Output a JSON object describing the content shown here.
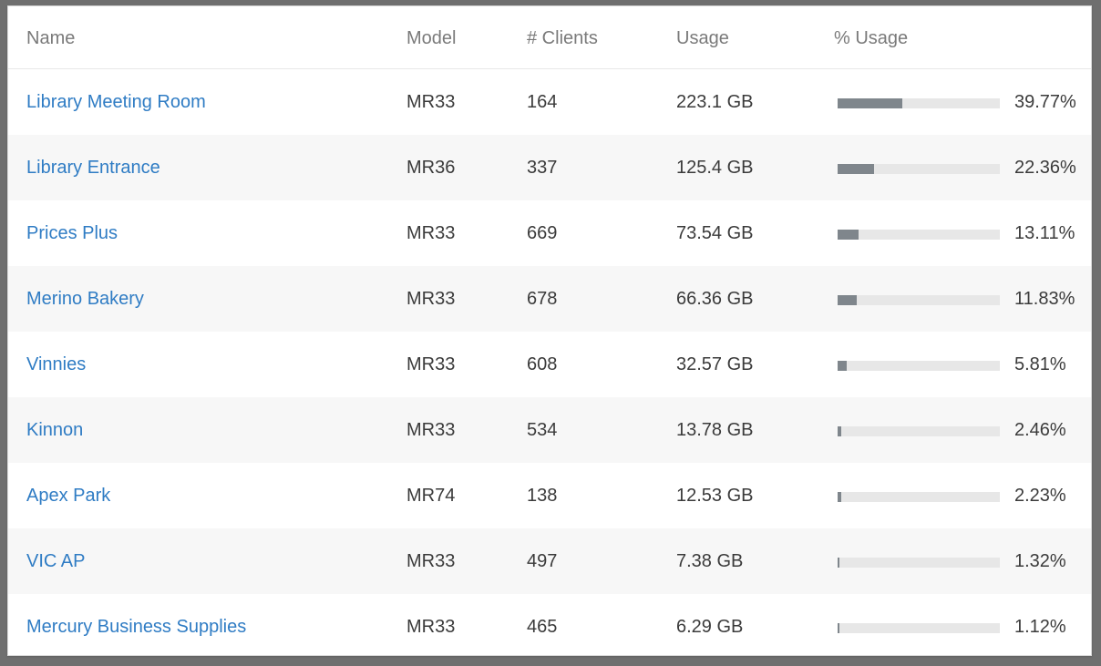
{
  "table": {
    "headers": {
      "name": "Name",
      "model": "Model",
      "clients": "# Clients",
      "usage": "Usage",
      "pct_usage": "% Usage"
    },
    "rows": [
      {
        "name": "Library Meeting Room",
        "model": "MR33",
        "clients": "164",
        "usage": "223.1 GB",
        "pct_label": "39.77%",
        "pct_value": 39.77
      },
      {
        "name": "Library Entrance",
        "model": "MR36",
        "clients": "337",
        "usage": "125.4 GB",
        "pct_label": "22.36%",
        "pct_value": 22.36
      },
      {
        "name": "Prices Plus",
        "model": "MR33",
        "clients": "669",
        "usage": "73.54 GB",
        "pct_label": "13.11%",
        "pct_value": 13.11
      },
      {
        "name": "Merino Bakery",
        "model": "MR33",
        "clients": "678",
        "usage": "66.36 GB",
        "pct_label": "11.83%",
        "pct_value": 11.83
      },
      {
        "name": "Vinnies",
        "model": "MR33",
        "clients": "608",
        "usage": "32.57 GB",
        "pct_label": "5.81%",
        "pct_value": 5.81
      },
      {
        "name": "Kinnon",
        "model": "MR33",
        "clients": "534",
        "usage": "13.78 GB",
        "pct_label": "2.46%",
        "pct_value": 2.46
      },
      {
        "name": "Apex Park",
        "model": "MR74",
        "clients": "138",
        "usage": "12.53 GB",
        "pct_label": "2.23%",
        "pct_value": 2.23
      },
      {
        "name": "VIC AP",
        "model": "MR33",
        "clients": "497",
        "usage": "7.38 GB",
        "pct_label": "1.32%",
        "pct_value": 1.32
      },
      {
        "name": "Mercury Business Supplies",
        "model": "MR33",
        "clients": "465",
        "usage": "6.29 GB",
        "pct_label": "1.12%",
        "pct_value": 1.12
      }
    ]
  },
  "colors": {
    "link": "#2f7cc4",
    "bar_fill": "#7f868c",
    "bar_track": "#e7e7e7",
    "row_alt": "#f7f7f7"
  }
}
